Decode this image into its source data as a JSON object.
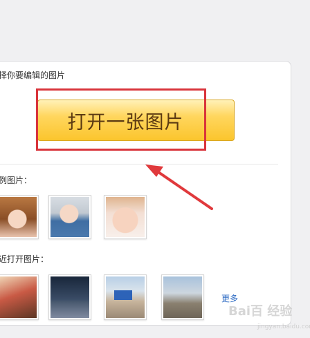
{
  "prompt": "选择你要编辑的图片",
  "open_button_label": "打开一张图片",
  "examples_title": "示例图片：",
  "recent_title": "最近打开图片：",
  "more_label": "更多",
  "watermark": "Bai百 经验",
  "watermark_sub": "jingyan.baidu.com",
  "colors": {
    "button_gradient_top": "#fff1b8",
    "button_gradient_bottom": "#fbc52d",
    "annotation_red": "#d9343b",
    "link_blue": "#2f6cc4"
  }
}
